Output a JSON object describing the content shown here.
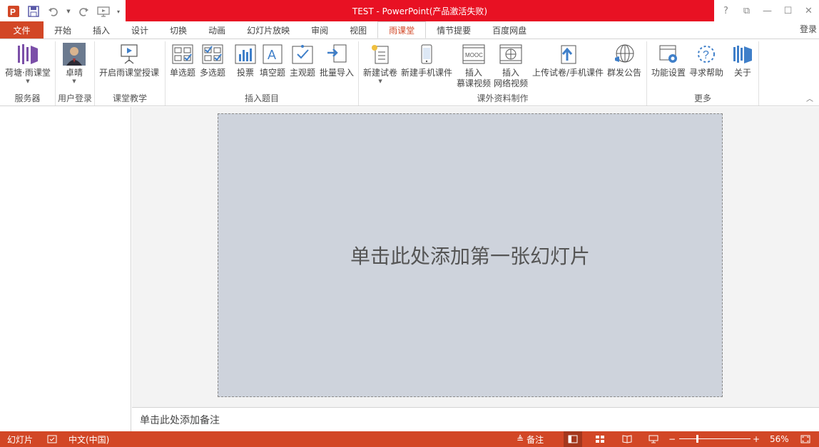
{
  "title": {
    "doc": "TEST -  PowerPoint(产品激活失败)"
  },
  "qat": {
    "icons": [
      "powerpoint-logo-icon",
      "save-icon",
      "undo-icon",
      "redo-icon",
      "presentation-from-start-icon",
      "customize-qat-icon"
    ]
  },
  "window": {
    "help": "?",
    "ribbon_options": "⧉",
    "minimize": "—",
    "restore": "☐",
    "close": "✕"
  },
  "tabs": [
    "文件",
    "开始",
    "插入",
    "设计",
    "切换",
    "动画",
    "幻灯片放映",
    "审阅",
    "视图",
    "雨课堂",
    "情节提要",
    "百度网盘"
  ],
  "active_tab": "雨课堂",
  "login": "登录",
  "ribbon": {
    "groups": [
      {
        "label": "服务器",
        "buttons": [
          "荷塘·雨课堂"
        ]
      },
      {
        "label": "用户登录",
        "buttons": [
          "卓晴"
        ]
      },
      {
        "label": "课堂教学",
        "buttons": [
          "开启雨课堂授课"
        ]
      },
      {
        "label": "插入题目",
        "buttons": [
          "单选题",
          "多选题",
          "投票",
          "填空题",
          "主观题",
          "批量导入"
        ]
      },
      {
        "label": "课外资料制作",
        "buttons": [
          "新建试卷",
          "新建手机课件",
          "插入",
          "插入",
          "上传试卷/手机课件",
          "群发公告"
        ],
        "sublabels": [
          "",
          "",
          "慕课视频",
          "网络视频",
          "",
          ""
        ]
      },
      {
        "label": "更多",
        "buttons": [
          "功能设置",
          "寻求帮助",
          "关于"
        ]
      }
    ],
    "mooc_icon_text": "MOOC"
  },
  "slide": {
    "placeholder": "单击此处添加第一张幻灯片"
  },
  "notes": {
    "placeholder": "单击此处添加备注"
  },
  "status": {
    "slides": "幻灯片",
    "language": "中文(中国)",
    "notes": "备注",
    "zoom": "56%",
    "zoom_minus": "−",
    "zoom_plus": "+"
  },
  "colors": {
    "accent": "#d24726",
    "title_bar": "#e81123",
    "slide_bg": "#ced3dc"
  }
}
